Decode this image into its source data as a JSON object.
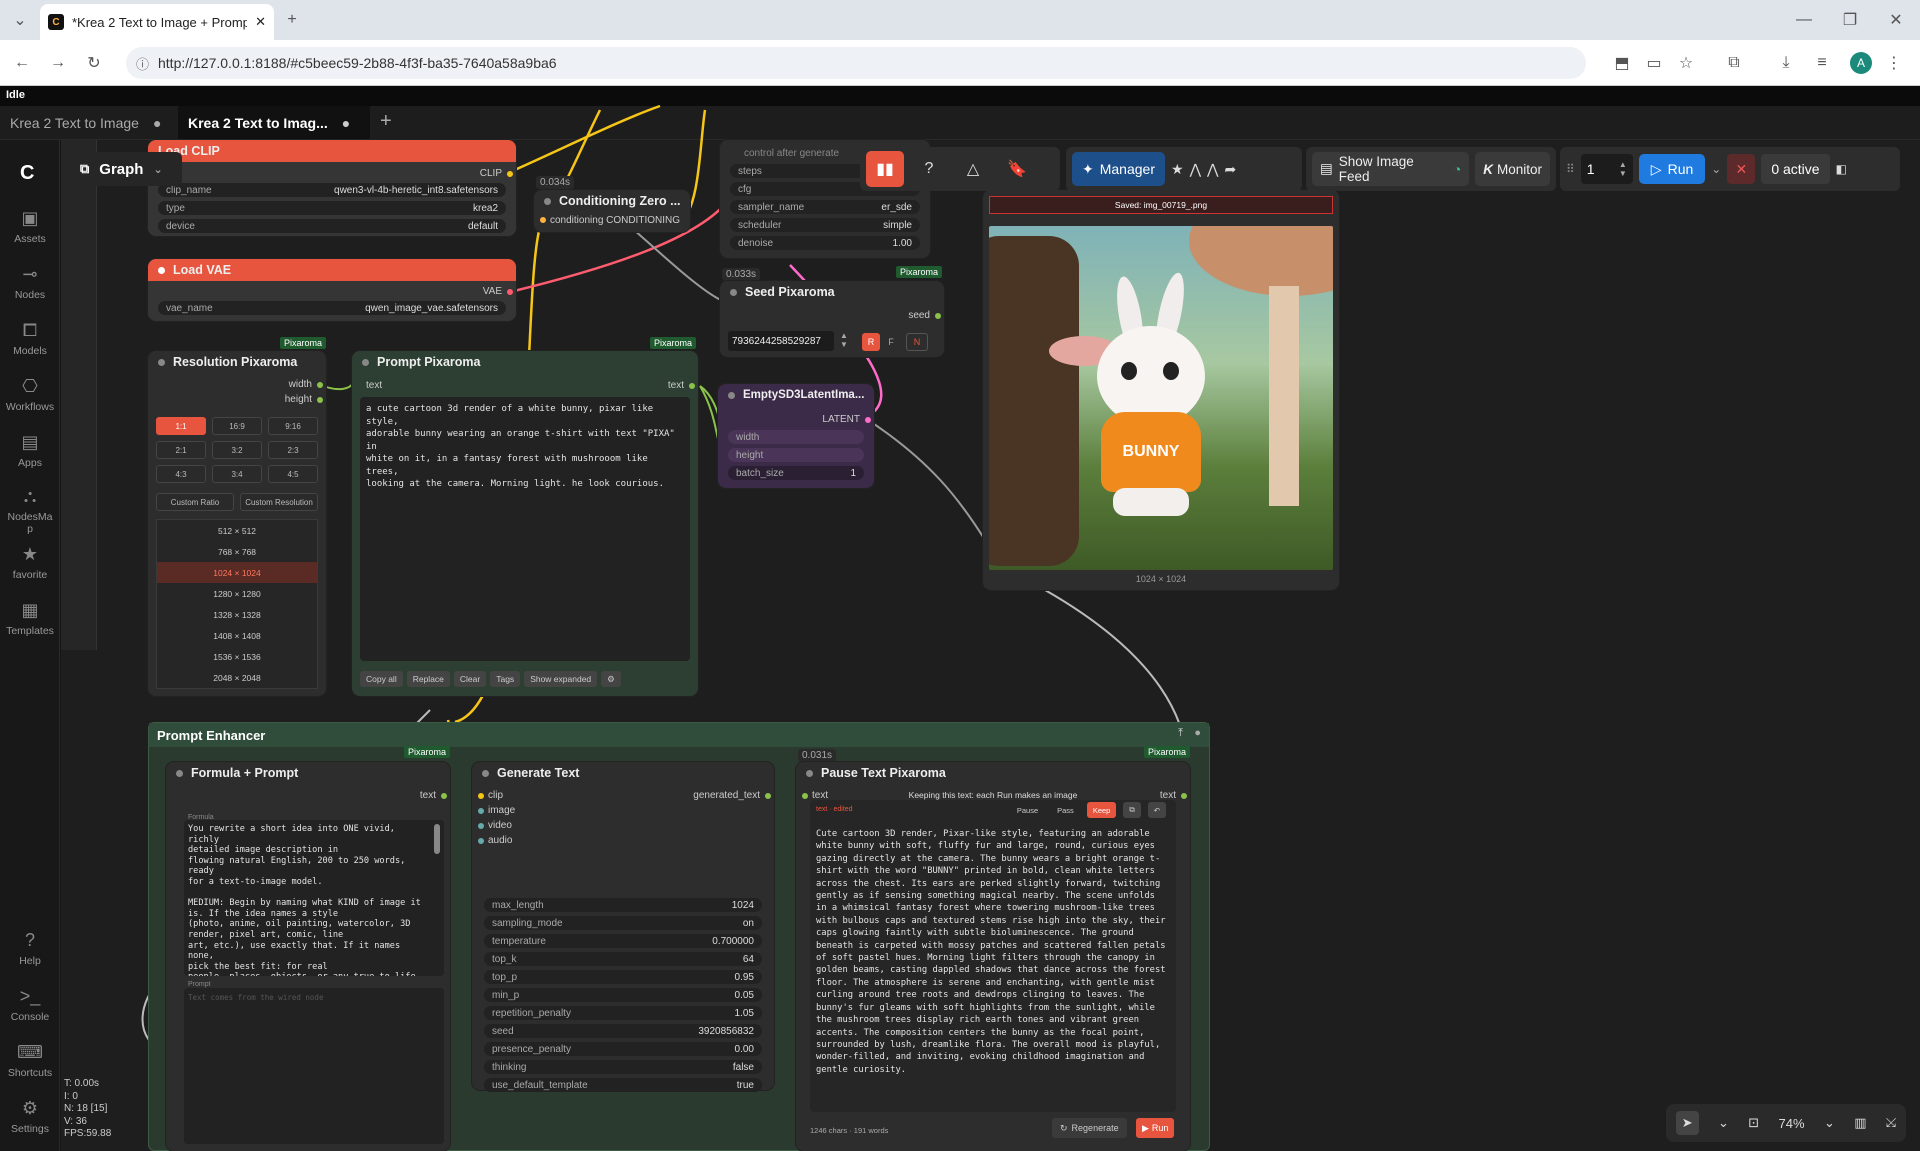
{
  "browser": {
    "tab_title": "*Krea 2 Text to Image + Prompt",
    "url": "http://127.0.0.1:8188/#c5beec59-2b88-4f3f-ba35-7640a58a9ba6",
    "profile_initial": "A"
  },
  "app": {
    "status": "Idle",
    "graph_label": "Graph",
    "workflow_tabs": [
      "Krea 2 Text to Image",
      "Krea 2 Text to Imag..."
    ]
  },
  "sidebar": {
    "items": [
      "Assets",
      "Nodes",
      "Models",
      "Workflows",
      "Apps",
      "NodesMap",
      "favorite",
      "Templates"
    ],
    "bottom": [
      "Help",
      "Console",
      "Shortcuts",
      "Settings"
    ]
  },
  "stats": {
    "t": "T: 0.00s",
    "i": "I: 0",
    "n": "N: 18 [15]",
    "v": "V: 36",
    "fps": "FPS:59.88"
  },
  "toolbar": {
    "manager": "Manager",
    "image_feed": "Show Image Feed",
    "monitor": "Monitor",
    "queue_count": "1",
    "run": "Run",
    "active": "0 active"
  },
  "nodes": {
    "load_clip": {
      "title": "Load CLIP",
      "out": "CLIP",
      "widgets": [
        {
          "k": "clip_name",
          "v": "qwen3-vl-4b-heretic_int8.safetensors"
        },
        {
          "k": "type",
          "v": "krea2"
        },
        {
          "k": "device",
          "v": "default"
        }
      ]
    },
    "conditioning_zero": {
      "title": "Conditioning Zero ...",
      "time": "0.034s",
      "port": "conditioning",
      "out": "CONDITIONING"
    },
    "ksampler": {
      "top_text": "control after generate",
      "widgets": [
        {
          "k": "steps",
          "v": ""
        },
        {
          "k": "cfg",
          "v": ""
        },
        {
          "k": "sampler_name",
          "v": "er_sde"
        },
        {
          "k": "scheduler",
          "v": "simple"
        },
        {
          "k": "denoise",
          "v": "1.00"
        }
      ]
    },
    "load_vae": {
      "title": "Load VAE",
      "out": "VAE",
      "widgets": [
        {
          "k": "vae_name",
          "v": "qwen_image_vae.safetensors"
        }
      ]
    },
    "seed": {
      "title": "Seed Pixaroma",
      "time": "0.033s",
      "out": "seed",
      "value": "793624425852928​7",
      "btns": [
        "R",
        "F",
        "N"
      ],
      "badge": "Pixaroma"
    },
    "resolution": {
      "title": "Resolution Pixaroma",
      "badge": "Pixaroma",
      "outs": [
        "width",
        "height"
      ],
      "ratios": [
        "1:1",
        "16:9",
        "9:16",
        "2:1",
        "3:2",
        "2:3",
        "4:3",
        "3:4",
        "4:5"
      ],
      "custom": [
        "Custom Ratio",
        "Custom Resolution"
      ],
      "sizes": [
        "512 × 512",
        "768 × 768",
        "1024 × 1024",
        "1280 × 1280",
        "1328 × 1328",
        "1408 × 1408",
        "1536 × 1536",
        "2048 × 2048"
      ],
      "selected_size": "1024 × 1024"
    },
    "prompt": {
      "title": "Prompt Pixaroma",
      "badge": "Pixaroma",
      "in": "text",
      "out": "text",
      "text": "a cute cartoon 3d render of a white bunny, pixar like style,\nadorable bunny wearing an orange t-shirt with text \"PIXA\" in\nwhite on it, in a fantasy forest with mushrooom like trees,\nlooking at the camera. Morning light. he look courious.",
      "buttons": [
        "Copy all",
        "Replace",
        "Clear",
        "Tags",
        "Show expanded"
      ]
    },
    "latent": {
      "title": "EmptySD3LatentIma...",
      "out": "LATENT",
      "widgets": [
        {
          "k": "width",
          "v": ""
        },
        {
          "k": "height",
          "v": ""
        },
        {
          "k": "batch_size",
          "v": "1"
        }
      ]
    },
    "preview": {
      "saved": "Saved: img_00719_.png",
      "caption": "1024 × 1024",
      "shirt_text": "BUNNY"
    },
    "group": {
      "title": "Prompt Enhancer",
      "time": "0.031s"
    },
    "formula": {
      "title": "Formula + Prompt",
      "badge": "Pixaroma",
      "out": "text",
      "formula_label": "Formula",
      "formula_text": "You rewrite a short idea into ONE vivid, richly\ndetailed image description in\nflowing natural English, 200 to 250 words, ready\nfor a text-to-image model.\n\nMEDIUM: Begin by naming what KIND of image it\nis. If the idea names a style\n(photo, anime, oil painting, watercolor, 3D\nrender, pixel art, comic, line\nart, etc.), use exactly that. If it names none,\npick the best fit: for real\npeople, places, objects, or any true-to-life\nscene, make it a realistic\nphotograph; for clearly cartoon, stylized, or",
      "prompt_label": "Prompt",
      "prompt_placeholder": "Text comes from the wired node"
    },
    "generate": {
      "title": "Generate Text",
      "ins": [
        "clip",
        "image",
        "video",
        "audio"
      ],
      "out": "generated_text",
      "widgets": [
        {
          "k": "max_length",
          "v": "1024"
        },
        {
          "k": "sampling_mode",
          "v": "on"
        },
        {
          "k": "temperature",
          "v": "0.700000"
        },
        {
          "k": "top_k",
          "v": "64"
        },
        {
          "k": "top_p",
          "v": "0.95"
        },
        {
          "k": "min_p",
          "v": "0.05"
        },
        {
          "k": "repetition_penalty",
          "v": "1.05"
        },
        {
          "k": "seed",
          "v": "3920856832"
        },
        {
          "k": "presence_penalty",
          "v": "0.00"
        },
        {
          "k": "thinking",
          "v": "false"
        },
        {
          "k": "use_default_template",
          "v": "true"
        }
      ]
    },
    "pause": {
      "title": "Pause Text Pixaroma",
      "badge": "Pixaroma",
      "in": "text",
      "out": "text",
      "hint": "Keeping this text: each Run makes an image",
      "edited_label": "text · edited",
      "controls": [
        "Pause",
        "Pass",
        "Keep"
      ],
      "text": "Cute cartoon 3D render, Pixar-like style, featuring an adorable white bunny with soft, fluffy fur and large, round, curious eyes gazing directly at the camera. The bunny wears a bright orange t-shirt with the word \"BUNNY\" printed in bold, clean white letters across the chest. Its ears are perked slightly forward, twitching gently as if sensing something magical nearby. The scene unfolds in a whimsical fantasy forest where towering mushroom-like trees with bulbous caps and textured stems rise high into the sky, their caps glowing faintly with subtle bioluminescence. The ground beneath is carpeted with mossy patches and scattered fallen petals of soft pastel hues. Morning light filters through the canopy in golden beams, casting dappled shadows that dance across the forest floor. The atmosphere is serene and enchanting, with gentle mist curling around tree roots and dewdrops clinging to leaves. The bunny's fur gleams with soft highlights from the sunlight, while the mushroom trees display rich earth tones and vibrant green accents. The composition centers the bunny as the focal point, surrounded by lush, dreamlike flora. The overall mood is playful, wonder-filled, and inviting, evoking childhood imagination and gentle curiosity.",
      "stats": "1246 chars · 191 words",
      "regenerate": "Regenerate",
      "run": "Run"
    }
  },
  "zoom": "74%",
  "colors": {
    "accent": "#e8553f",
    "run_blue": "#1f7be0",
    "manager_blue": "#1d4f8a",
    "group_green": "#2f4d3a"
  }
}
